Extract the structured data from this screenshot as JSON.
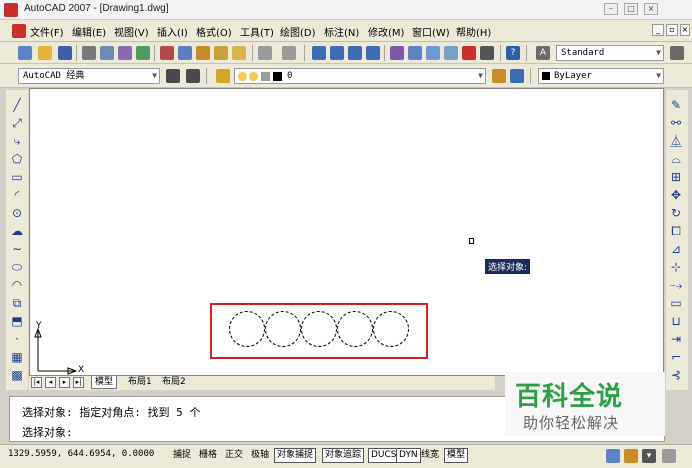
{
  "window": {
    "title": "AutoCAD 2007 - [Drawing1.dwg]"
  },
  "menu": {
    "items": [
      "文件(F)",
      "编辑(E)",
      "视图(V)",
      "插入(I)",
      "格式(O)",
      "工具(T)",
      "绘图(D)",
      "标注(N)",
      "修改(M)",
      "窗口(W)",
      "帮助(H)"
    ]
  },
  "toolbar": {
    "text_style": "Standard",
    "workspace": "AutoCAD 经典",
    "layer": "0",
    "color": "ByLayer"
  },
  "drawing": {
    "tooltip": "选择对象:",
    "circles_count": 5,
    "axis_x": "X",
    "axis_y": "Y"
  },
  "layout_tabs": [
    "模型",
    "布局1",
    "布局2"
  ],
  "command": {
    "line1": "选择对象: 指定对角点: 找到 5 个",
    "line2": "选择对象:"
  },
  "watermark": {
    "title": "百科全说",
    "subtitle": "助你轻松解决"
  },
  "status": {
    "coords": "1329.5959, 644.6954, 0.0000",
    "buttons": [
      "捕捉",
      "栅格",
      "正交",
      "极轴",
      "对象捕捉",
      "对象追踪",
      "DUCS",
      "DYN",
      "线宽",
      "模型"
    ]
  },
  "colors": {
    "accent_red": "#d32020",
    "tooltip_bg": "#1d2a5c",
    "watermark_green": "#2f9e46"
  }
}
